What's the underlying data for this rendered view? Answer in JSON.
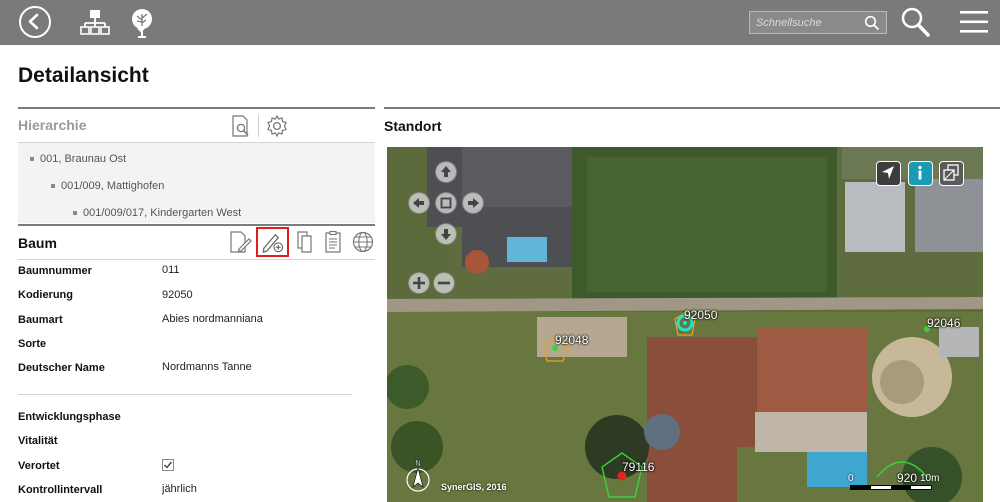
{
  "topbar": {
    "search_placeholder": "Schnellsuche",
    "background": "#7a7a7a"
  },
  "page": {
    "title": "Detailansicht"
  },
  "hierarchy": {
    "title": "Hierarchie",
    "items": [
      {
        "label": "001, Braunau Ost",
        "level": 0
      },
      {
        "label": "001/009, Mattighofen",
        "level": 1
      },
      {
        "label": "001/009/017, Kindergarten West",
        "level": 2
      }
    ]
  },
  "tree": {
    "title": "Baum",
    "fields": [
      {
        "label": "Baumnummer",
        "value": "011"
      },
      {
        "label": "Kodierung",
        "value": "92050"
      },
      {
        "label": "Baumart",
        "value": "Abies nordmanniana"
      },
      {
        "label": "Sorte",
        "value": ""
      },
      {
        "label": "Deutscher Name",
        "value": "Nordmanns Tanne"
      }
    ],
    "fields2": [
      {
        "label": "Entwicklungsphase",
        "value": ""
      },
      {
        "label": "Vitalität",
        "value": ""
      },
      {
        "label": "Verortet",
        "value": "checked"
      },
      {
        "label": "Kontrollintervall",
        "value": "jährlich"
      }
    ],
    "highlight_color": "#e11d1d"
  },
  "location": {
    "title": "Standort",
    "map_labels": [
      {
        "id": "92050",
        "text": "92050"
      },
      {
        "id": "92048",
        "text": "92048"
      },
      {
        "id": "92046",
        "text": "92046"
      },
      {
        "id": "79116",
        "text": "79116"
      },
      {
        "id": "92042",
        "text": "920"
      }
    ],
    "copyright": "SynerGIS, 2016",
    "scale": {
      "start": "0",
      "end": "10m"
    },
    "north": "N",
    "accent": "#1a9bb5"
  }
}
